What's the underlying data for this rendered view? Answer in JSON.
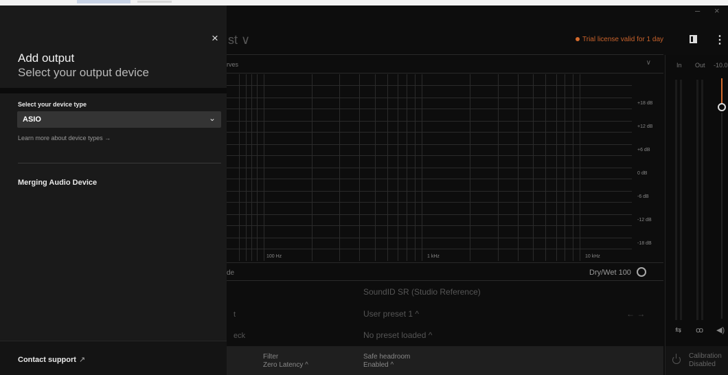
{
  "window": {
    "minimize": "–",
    "close": "×"
  },
  "header": {
    "preset_title": "st ∨",
    "trial": "Trial license valid for 1 day",
    "trial_color": "#d46a2c"
  },
  "curves": {
    "label": "rves",
    "chevron": "∨"
  },
  "graph": {
    "db_labels": [
      "+18 dB",
      "+12 dB",
      "+6 dB",
      "0 dB",
      "-6 dB",
      "-12 dB",
      "-18 dB"
    ],
    "hz_labels": [
      "100 Hz",
      "1 kHz",
      "10 kHz"
    ]
  },
  "controls": {
    "mode_label": "de",
    "drywet": "Dry/Wet 100",
    "reference": "SoundID SR (Studio Reference)",
    "row2_label": "t",
    "user_preset": "User preset 1 ^",
    "arrows": "← →",
    "row3_label": "eck",
    "no_preset": "No preset loaded ^"
  },
  "bottom": {
    "filter_label": "Filter",
    "filter_value": "Zero Latency ^",
    "headroom_label": "Safe headroom",
    "headroom_value": "Enabled ^"
  },
  "meters": {
    "in": "In",
    "out": "Out",
    "level": "-10.0",
    "icons": [
      "⇆",
      "ꝏ",
      "◀)"
    ],
    "calibration_label": "Calibration",
    "calibration_value": "Disabled"
  },
  "panel": {
    "close": "×",
    "title": "Add output",
    "subtitle": "Select your output device",
    "type_label": "Select your device type",
    "type_value": "ASIO",
    "type_chevron": "⌄",
    "learn_link": "Learn more about device types →",
    "devices": [
      "Merging Audio Device"
    ],
    "contact": "Contact support",
    "contact_icon": "↗"
  }
}
